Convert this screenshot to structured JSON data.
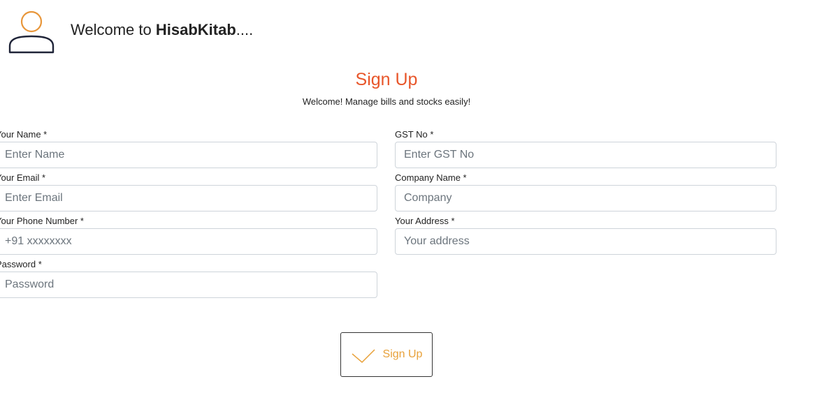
{
  "header": {
    "welcome_prefix": "Welcome to ",
    "brand": "HisabKitab",
    "suffix": "....",
    "avatar_icon": "user-icon",
    "avatar_head_color": "#e8963a",
    "avatar_body_color": "#1f2438"
  },
  "form": {
    "title": "Sign Up",
    "subtitle": "Welcome! Manage bills and stocks easily!",
    "title_color": "#e8562a",
    "fields": {
      "name": {
        "label": "Your Name *",
        "placeholder": "Enter Name"
      },
      "email": {
        "label": "Your Email *",
        "placeholder": "Enter Email"
      },
      "phone": {
        "label": "Your Phone Number *",
        "placeholder": "+91 xxxxxxxx"
      },
      "password": {
        "label": "Password *",
        "placeholder": "Password"
      },
      "gst": {
        "label": "GST No *",
        "placeholder": "Enter GST No"
      },
      "company": {
        "label": "Company Name *",
        "placeholder": "Company"
      },
      "address": {
        "label": "Your Address *",
        "placeholder": "Your address"
      }
    },
    "submit": {
      "label": "Sign Up",
      "icon": "checkmark-icon",
      "color": "#e8a13a"
    }
  }
}
